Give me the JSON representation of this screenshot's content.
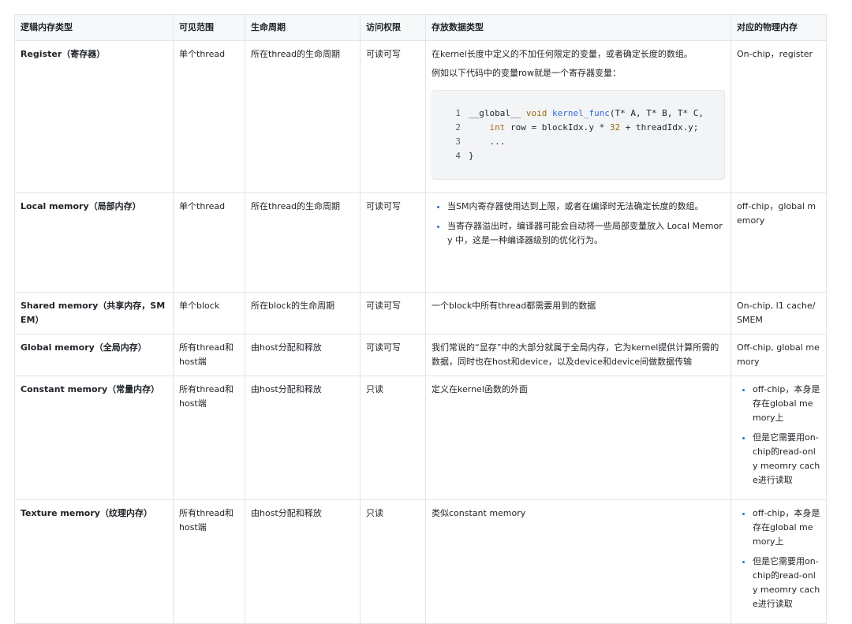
{
  "headers": [
    "逻辑内存类型",
    "可见范围",
    "生命周期",
    "访问权限",
    "存放数据类型",
    "对应的物理内存"
  ],
  "rows": [
    {
      "name": "Register（寄存器）",
      "scope": "单个thread",
      "lifetime": "所在thread的生命周期",
      "access": "可读可写",
      "data_paragraphs": [
        "在kernel长度中定义的不加任何限定的变量，或者确定长度的数组。",
        "例如以下代码中的变量row就是一个寄存器变量："
      ],
      "code": {
        "line_numbers": [
          "1",
          "2",
          "3",
          "4"
        ],
        "line1_prefix": "__global__ ",
        "line1_kw": "void",
        "line1_fn": "kernel_func",
        "line1_rest": "(T* A, T* B, T* C, ",
        "line2_indent": "    ",
        "line2_kw": "int",
        "line2_mid": " row = blockIdx.y * ",
        "line2_num": "32",
        "line2_end": " + threadIdx.y;",
        "line3": "    ...",
        "line4": "}"
      },
      "physical": "On-chip，register"
    },
    {
      "name": "Local memory（局部内存）",
      "scope": "单个thread",
      "lifetime": "所在thread的生命周期",
      "access": "可读可写",
      "data_bullets": [
        "当SM内寄存器使用达到上限，或者在编译时无法确定长度的数组。",
        "当寄存器溢出时，编译器可能会自动将一些局部变量放入 Local Memory 中，这是一种编译器级别的优化行为。"
      ],
      "physical": "off-chip，global memory"
    },
    {
      "name": "Shared memory（共享内存，SMEM）",
      "scope": "单个block",
      "lifetime": "所在block的生命周期",
      "access": "可读可写",
      "data_text": "一个block中所有thread都需要用到的数据",
      "physical": "On-chip, l1 cache/SMEM"
    },
    {
      "name": "Global memory（全局内存）",
      "scope": "所有thread和host端",
      "lifetime": "由host分配和释放",
      "access": "可读可写",
      "data_text": "我们常说的“显存”中的大部分就属于全局内存，它为kernel提供计算所需的数据，同时也在host和device，以及device和device间做数据传输",
      "physical": "Off-chip, global memory"
    },
    {
      "name": "Constant memory（常量内存）",
      "scope": "所有thread和host端",
      "lifetime": "由host分配和释放",
      "access": "只读",
      "data_text": "定义在kernel函数的外面",
      "physical_bullets": [
        "off-chip，本身是存在global memory上",
        "但是它需要用on-chip的read-only meomry cache进行读取"
      ]
    },
    {
      "name": "Texture memory（纹理内存）",
      "scope": "所有thread和host端",
      "lifetime": "由host分配和释放",
      "access": "只读",
      "data_text": "类似constant memory",
      "physical_bullets": [
        "off-chip，本身是存在global memory上",
        "但是它需要用on-chip的read-only meomry cache进行读取"
      ]
    }
  ]
}
